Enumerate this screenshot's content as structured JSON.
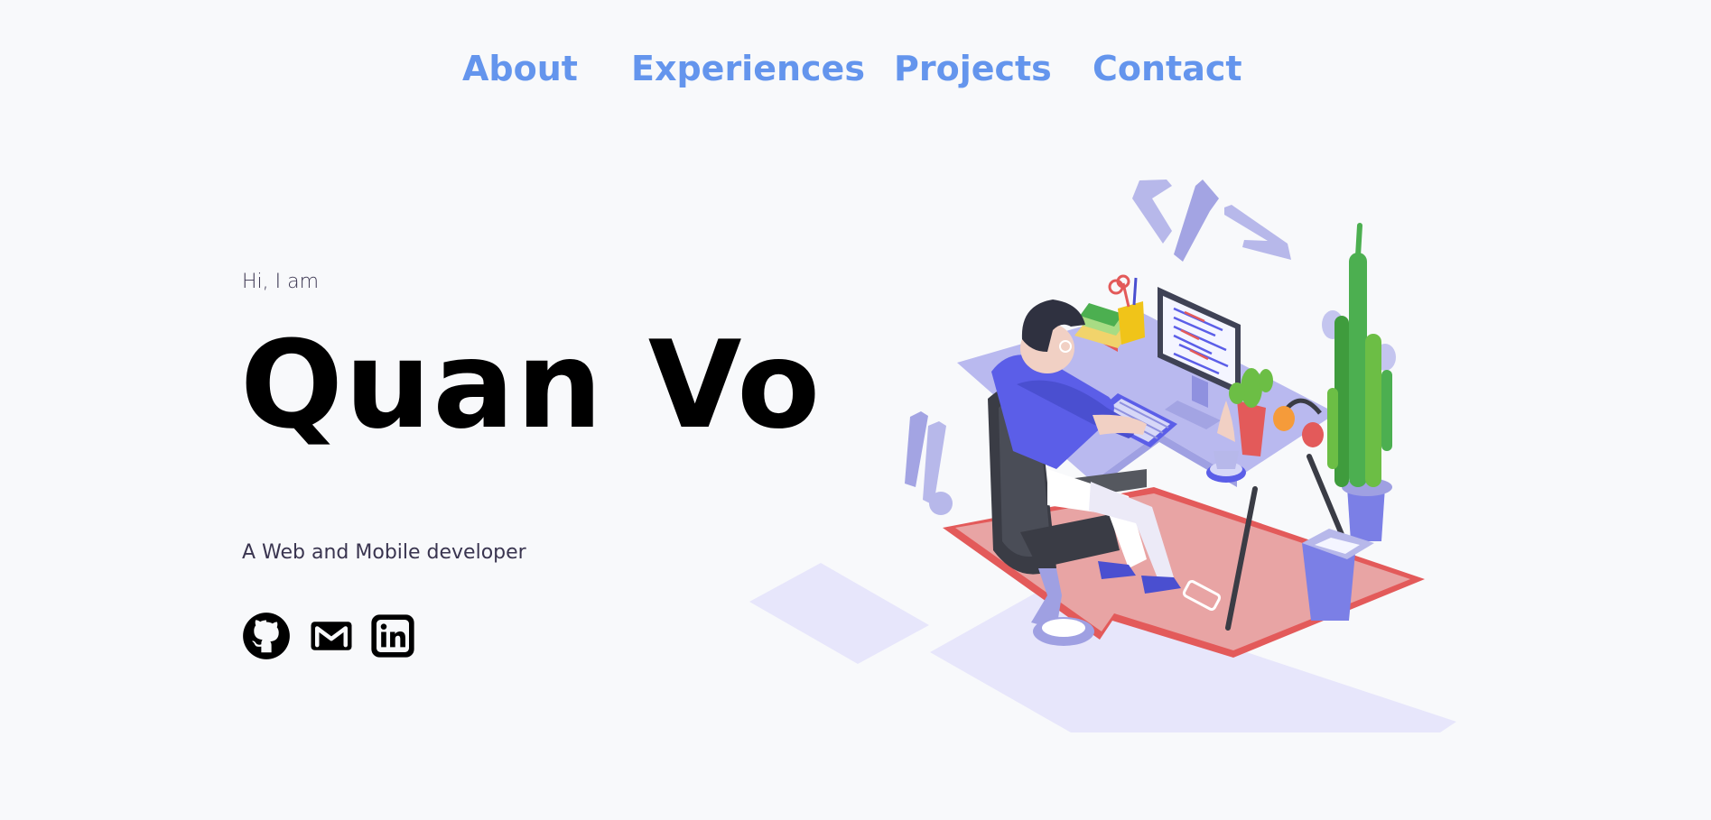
{
  "nav": {
    "items": [
      {
        "label": "About"
      },
      {
        "label": "Experiences"
      },
      {
        "label": "Projects"
      },
      {
        "label": "Contact"
      }
    ]
  },
  "hero": {
    "greeting": "Hi, I am",
    "name": "Quan Vo",
    "role": "A Web and Mobile developer"
  },
  "socials": [
    {
      "icon": "github-icon"
    },
    {
      "icon": "gmail-icon"
    },
    {
      "icon": "linkedin-icon"
    }
  ],
  "colors": {
    "background": "#f8f9fb",
    "nav_link": "#6495ed",
    "heading": "#000000",
    "body_text": "#3a3550",
    "illustration_accent": "#5b5ee8",
    "illustration_lavender": "#b7b8ea",
    "illustration_rug": "#e35a5a"
  }
}
